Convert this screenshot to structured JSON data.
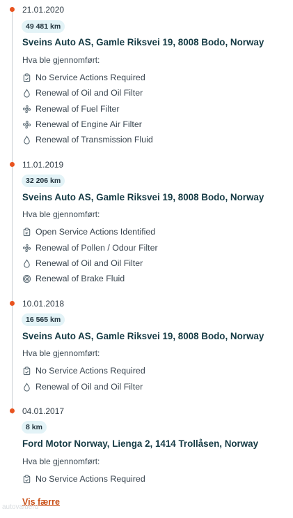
{
  "performed_label": "Hva ble gjennomført:",
  "show_less": "Vis færre",
  "watermark": "autovaluerd",
  "accent_color": "#e8531f",
  "entries": [
    {
      "date": "21.01.2020",
      "mileage": "49 481 km",
      "workshop": "Sveins Auto AS, Gamle Riksvei 19, 8008 Bodo, Norway",
      "actions": [
        {
          "icon": "clipboard-icon",
          "label": "No Service Actions Required"
        },
        {
          "icon": "oil-drop-icon",
          "label": "Renewal of Oil and Oil Filter"
        },
        {
          "icon": "fan-icon",
          "label": "Renewal of Fuel Filter"
        },
        {
          "icon": "fan-icon",
          "label": "Renewal of Engine Air Filter"
        },
        {
          "icon": "oil-drop-icon",
          "label": "Renewal of Transmission Fluid"
        }
      ]
    },
    {
      "date": "11.01.2019",
      "mileage": "32 206 km",
      "workshop": "Sveins Auto AS, Gamle Riksvei 19, 8008 Bodo, Norway",
      "actions": [
        {
          "icon": "clipboard-icon",
          "label": "Open Service Actions Identified"
        },
        {
          "icon": "fan-icon",
          "label": "Renewal of Pollen / Odour Filter"
        },
        {
          "icon": "oil-drop-icon",
          "label": "Renewal of Oil and Oil Filter"
        },
        {
          "icon": "brake-disc-icon",
          "label": "Renewal of Brake Fluid"
        }
      ]
    },
    {
      "date": "10.01.2018",
      "mileage": "16 565 km",
      "workshop": "Sveins Auto AS, Gamle Riksvei 19, 8008 Bodo, Norway",
      "actions": [
        {
          "icon": "clipboard-icon",
          "label": "No Service Actions Required"
        },
        {
          "icon": "oil-drop-icon",
          "label": "Renewal of Oil and Oil Filter"
        }
      ]
    },
    {
      "date": "04.01.2017",
      "mileage": "8 km",
      "workshop": "Ford Motor Norway, Lienga 2, 1414 Trollåsen, Norway",
      "actions": [
        {
          "icon": "clipboard-icon",
          "label": "No Service Actions Required"
        }
      ]
    }
  ]
}
